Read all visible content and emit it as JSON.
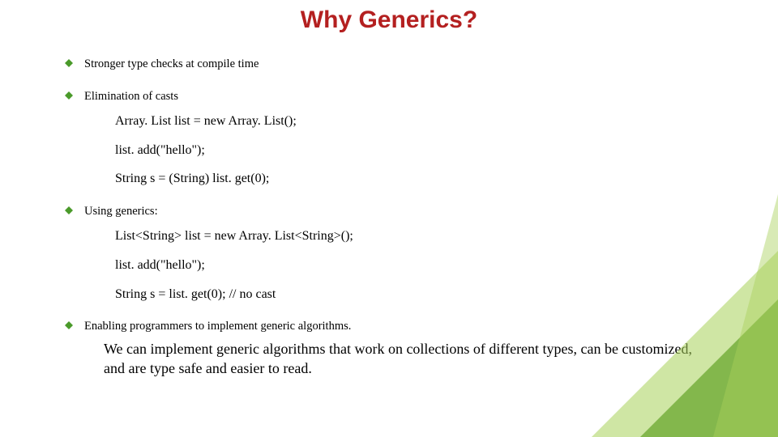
{
  "title": "Why Generics?",
  "bullets": {
    "b1": "Stronger type checks at compile time",
    "b2": "Elimination of casts",
    "b3": "Using generics:",
    "b4": "Enabling programmers to implement generic algorithms."
  },
  "code1": {
    "l1": "Array. List list = new Array. List();",
    "l2": "list. add(\"hello\");",
    "l3": "String s = (String) list. get(0);"
  },
  "code2": {
    "l1": "List<String> list = new Array. List<String>();",
    "l2": "list. add(\"hello\");",
    "l3": "String s = list. get(0); // no cast"
  },
  "closing": "We can implement generic algorithms that work on collections of different types, can be customized, and are type safe and easier to read.",
  "colors": {
    "title": "#b42020",
    "bullet": "#4a9a2a",
    "deco_dark": "#6aa72f",
    "deco_light": "#a8d15a"
  }
}
